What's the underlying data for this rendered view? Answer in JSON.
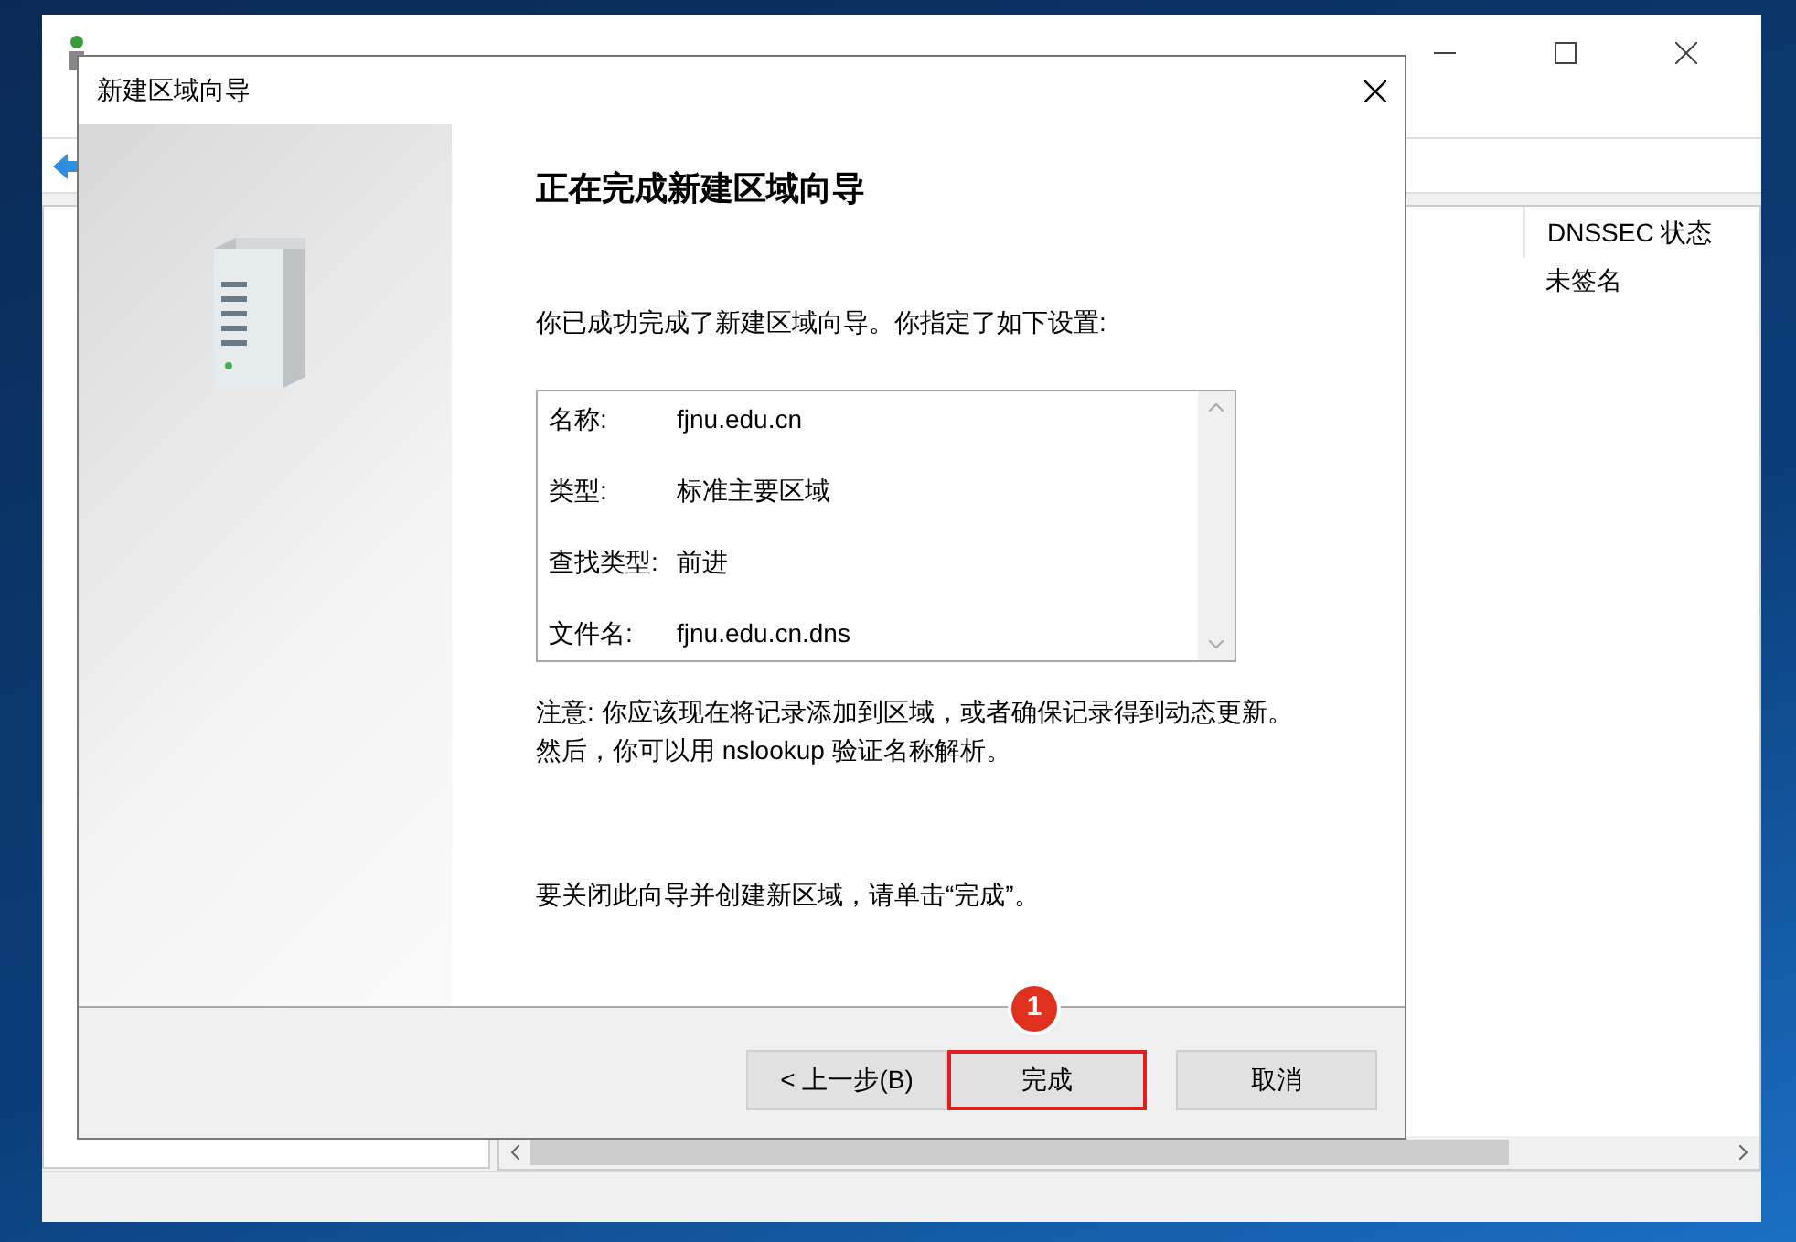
{
  "background_window": {
    "columns": [
      "DNSSEC 状态"
    ],
    "rows": [
      {
        "cells": [
          "未签名"
        ]
      }
    ]
  },
  "dialog": {
    "title": "新建区域向导",
    "heading": "正在完成新建区域向导",
    "intro": "你已成功完成了新建区域向导。你指定了如下设置:",
    "summary": [
      {
        "label": "名称:",
        "value": "fjnu.edu.cn"
      },
      {
        "label": "类型:",
        "value": "标准主要区域"
      },
      {
        "label": "查找类型:",
        "value": "前进"
      },
      {
        "label": "文件名:",
        "value": "fjnu.edu.cn.dns"
      }
    ],
    "note": "注意: 你应该现在将记录添加到区域，或者确保记录得到动态更新。然后，你可以用 nslookup 验证名称解析。",
    "closing": "要关闭此向导并创建新区域，请单击“完成”。",
    "buttons": [
      {
        "label": "< 上一步(B)",
        "highlighted": false
      },
      {
        "label": "完成",
        "highlighted": true
      },
      {
        "label": "取消",
        "highlighted": false
      }
    ],
    "annotation": "1"
  }
}
